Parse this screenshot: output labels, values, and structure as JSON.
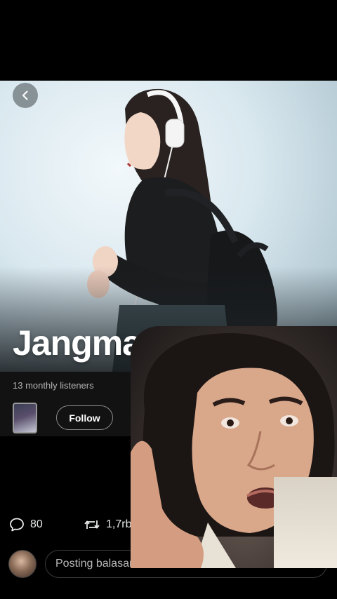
{
  "artist": {
    "name": "Jangma",
    "listeners": "13 monthly listeners",
    "follow_label": "Follow"
  },
  "post_actions": {
    "replies": "80",
    "reposts": "1,7rb"
  },
  "reply": {
    "placeholder": "Posting balasan Anda"
  },
  "colors": {
    "background": "#000000",
    "panel": "#121212",
    "muted_text": "#b3b3b3"
  }
}
